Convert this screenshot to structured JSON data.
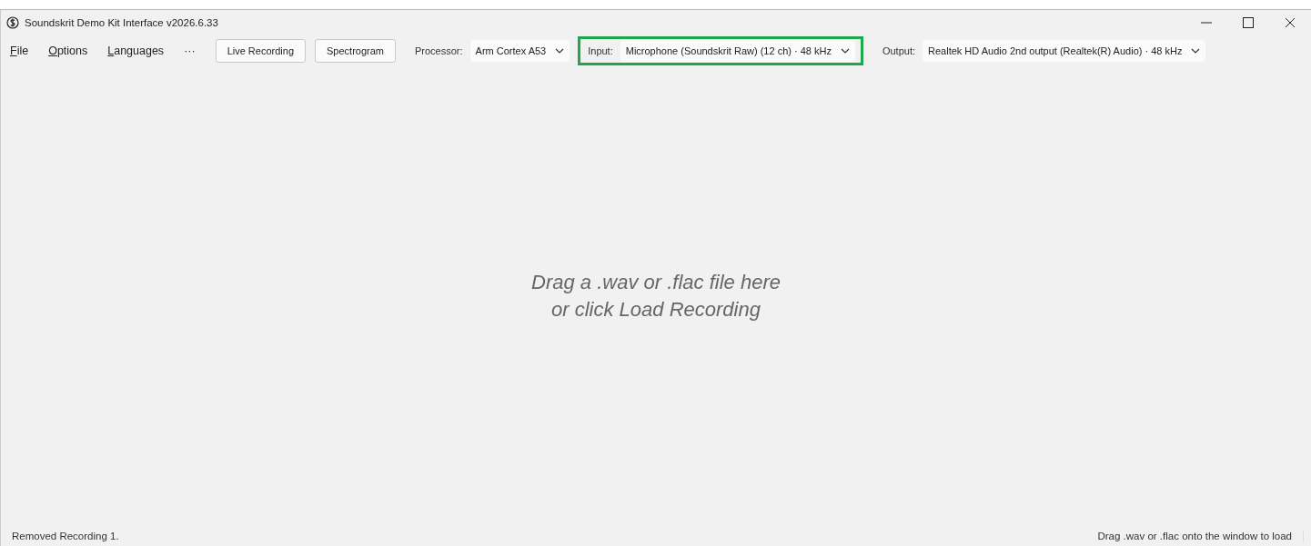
{
  "window": {
    "title": "Soundskrit Demo Kit Interface v2026.6.33"
  },
  "menu": [
    "File",
    "Options",
    "Languages",
    "···"
  ],
  "buttons": [
    "Live Recording",
    "Spectrogram"
  ],
  "selectors": [
    {
      "label": "Processor:",
      "value": "Arm Cortex A53",
      "highlighted": false
    },
    {
      "label": "Input:",
      "value": "Microphone (Soundskrit Raw)  (12 ch) · 48 kHz",
      "highlighted": true
    },
    {
      "label": "Output:",
      "value": "Realtek HD Audio 2nd output (Realtek(R) Audio) · 48 kHz",
      "highlighted": false
    }
  ],
  "drop_hint": [
    "Drag a .wav or .flac file here",
    "or click Load Recording"
  ],
  "status_bar": {
    "message": "Removed Recording 1.",
    "hint": "Drag .wav or .flac onto the window to load"
  }
}
